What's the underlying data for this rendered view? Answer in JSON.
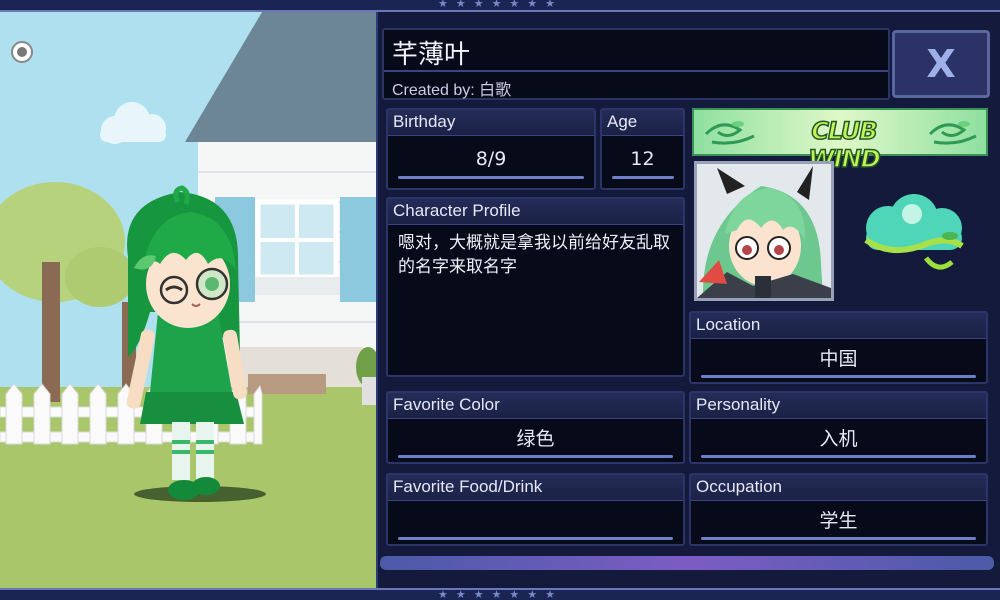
{
  "character": {
    "name": "芊薄叶",
    "created_by_label": "Created by:",
    "creator": "白歌"
  },
  "close_button": {
    "label": "X"
  },
  "fields": {
    "birthday": {
      "label": "Birthday",
      "value": "8/9"
    },
    "age": {
      "label": "Age",
      "value": "12"
    },
    "profile": {
      "label": "Character Profile",
      "value": "嗯对，大概就是拿我以前给好友乱取的名字来取名字"
    },
    "location": {
      "label": "Location",
      "value": "中国"
    },
    "favorite_color": {
      "label": "Favorite Color",
      "value": "绿色"
    },
    "personality": {
      "label": "Personality",
      "value": "入机"
    },
    "favorite_food": {
      "label": "Favorite Food/Drink",
      "value": ""
    },
    "occupation": {
      "label": "Occupation",
      "value": "学生"
    }
  },
  "club": {
    "banner_text": "CLUB WIND",
    "icon": "wind-cloud-icon"
  },
  "colors": {
    "panel_bg": "#141a3c",
    "field_bg": "#070a18",
    "header_bg": "#242c58",
    "accent_line": "#6f80c8",
    "character_green": "#1fa34a"
  },
  "icons": {
    "menu": "menu-circle-icon",
    "close": "close-icon"
  }
}
